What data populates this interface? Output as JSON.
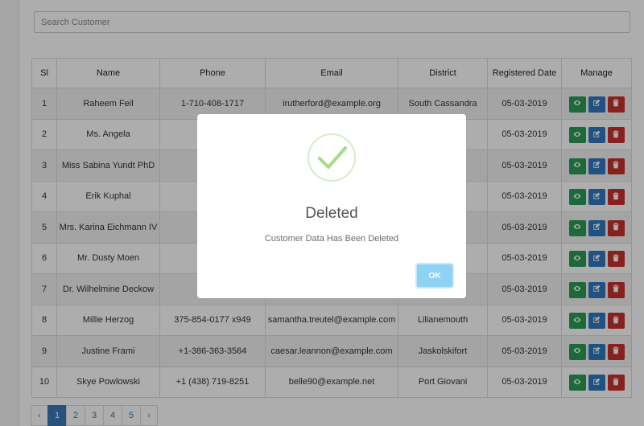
{
  "search": {
    "placeholder": "Search Customer"
  },
  "table": {
    "headers": [
      "Sl",
      "Name",
      "Phone",
      "Email",
      "District",
      "Registered Date",
      "Manage"
    ],
    "rows": [
      {
        "sl": "1",
        "name": "Raheem Feil",
        "phone": "1-710-408-1717",
        "email": "irutherford@example.org",
        "district": "South Cassandra",
        "date": "05-03-2019"
      },
      {
        "sl": "2",
        "name": "Ms. Angela",
        "phone": "674-53",
        "email": "",
        "district": "",
        "date": "05-03-2019"
      },
      {
        "sl": "3",
        "name": "Miss Sabina Yundt PhD",
        "phone": "86",
        "email": "",
        "district": "",
        "date": "05-03-2019"
      },
      {
        "sl": "4",
        "name": "Erik Kuphal",
        "phone": "994",
        "email": "",
        "district": "",
        "date": "05-03-2019"
      },
      {
        "sl": "5",
        "name": "Mrs. Karina Eichmann IV",
        "phone": "885",
        "email": "",
        "district": "ster",
        "date": "05-03-2019"
      },
      {
        "sl": "6",
        "name": "Mr. Dusty Moen",
        "phone": "1-904-9",
        "email": "",
        "district": "d",
        "date": "05-03-2019"
      },
      {
        "sl": "7",
        "name": "Dr. Wilhelmine Deckow",
        "phone": "+1.2",
        "email": "",
        "district": "",
        "date": "05-03-2019"
      },
      {
        "sl": "8",
        "name": "Millie Herzog",
        "phone": "375-854-0177 x949",
        "email": "samantha.treutel@example.com",
        "district": "Lilianemouth",
        "date": "05-03-2019"
      },
      {
        "sl": "9",
        "name": "Justine Frami",
        "phone": "+1-386-363-3564",
        "email": "caesar.leannon@example.com",
        "district": "Jaskolskifort",
        "date": "05-03-2019"
      },
      {
        "sl": "10",
        "name": "Skye Powlowski",
        "phone": "+1 (438) 719-8251",
        "email": "belle90@example.net",
        "district": "Port Giovani",
        "date": "05-03-2019"
      }
    ],
    "actions": {
      "view_icon": "eye-icon",
      "edit_icon": "edit-icon",
      "delete_icon": "trash-icon"
    }
  },
  "pagination": {
    "prev": "‹",
    "pages": [
      "1",
      "2",
      "3",
      "4",
      "5"
    ],
    "current": "1",
    "next": "›"
  },
  "modal": {
    "icon": "check-icon",
    "title": "Deleted",
    "message": "Customer Data Has Been Deleted",
    "ok_label": "OK"
  },
  "colors": {
    "view": "#2a9b54",
    "edit": "#2f7ac0",
    "delete": "#c9302c",
    "ok_button": "#8ed3f3",
    "check": "#a5dc86"
  }
}
